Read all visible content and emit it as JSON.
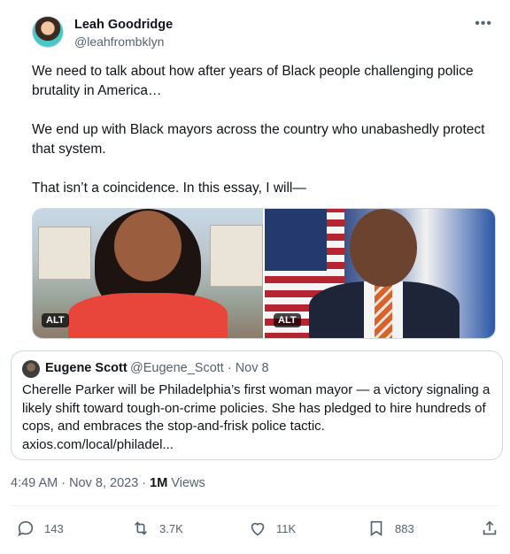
{
  "author": {
    "name": "Leah Goodridge",
    "handle": "@leahfrombklyn"
  },
  "tweet": {
    "paragraphs": [
      "We need to talk about how after years of Black people challenging police brutality in America…",
      "We end up with Black mayors across the country who unabashedly protect that system.",
      "That isn’t a coincidence. In this essay, I will—"
    ]
  },
  "media": {
    "images": [
      {
        "alt_label": "ALT"
      },
      {
        "alt_label": "ALT"
      }
    ]
  },
  "quote": {
    "name": "Eugene Scott",
    "meta": "@Eugene_Scott · Nov 8",
    "text": "Cherelle Parker will be Philadelphia’s first woman mayor — a victory signaling a likely shift toward tough-on-crime policies. She has pledged to hire hundreds of cops, and embraces the stop-and-frisk police tactic.",
    "link": "axios.com/local/philadel..."
  },
  "meta": {
    "timestamp": "4:49 AM · Nov 8, 2023 · ",
    "views_count": "1M",
    "views_label": " Views"
  },
  "actions": {
    "replies": "143",
    "reposts": "3.7K",
    "likes": "11K",
    "bookmarks": "883"
  },
  "icons": {
    "more": "more-dots-icon",
    "reply": "reply-icon",
    "repost": "repost-icon",
    "like": "heart-icon",
    "bookmark": "bookmark-icon",
    "share": "share-icon"
  },
  "colors": {
    "text": "#0f1419",
    "secondary": "#536471",
    "border": "#cfd9de"
  }
}
